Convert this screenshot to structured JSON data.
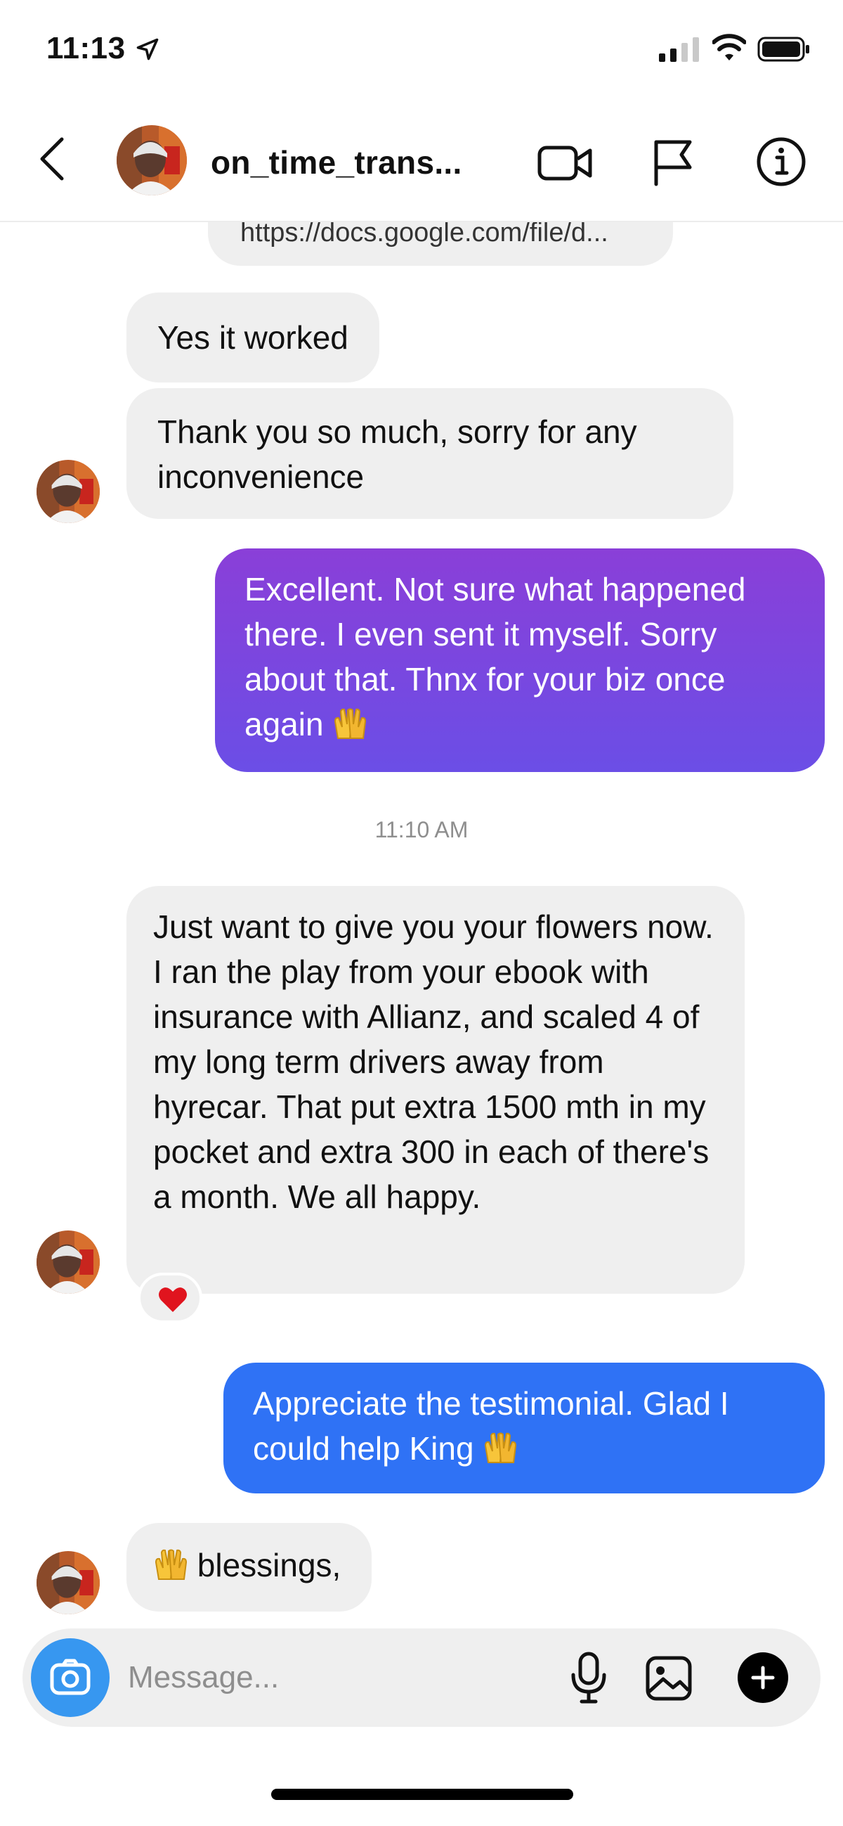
{
  "status_bar": {
    "time": "11:13"
  },
  "header": {
    "name": "on_time_trans..."
  },
  "thread": {
    "link_preview": "https://docs.google.com/file/d...",
    "messages": [
      {
        "side": "in",
        "text": "Yes it worked"
      },
      {
        "side": "in",
        "text": "Thank you so much, sorry for any inconvenience"
      },
      {
        "side": "out",
        "text": "Excellent. Not sure what happened there. I even sent it myself. Sorry about that. Thnx for your biz once again"
      },
      {
        "side": "in",
        "text": "Just want to give you your flowers now. I ran the play from your ebook with insurance with Allianz, and scaled 4 of my long term drivers away from hyrecar. That put extra 1500 mth in my pocket and extra 300 in each of there's a month.  We all happy."
      },
      {
        "side": "out",
        "text": "Appreciate the testimonial. Glad I could help King"
      },
      {
        "side": "in",
        "text": "blessings,"
      }
    ],
    "timestamp": "11:10 AM",
    "reaction": "heart"
  },
  "composer": {
    "placeholder": "Message..."
  },
  "icons": {
    "back": "chevron-left-icon",
    "video": "video-call-icon",
    "flag": "flag-icon",
    "info": "info-icon",
    "camera": "camera-icon",
    "mic": "microphone-icon",
    "gallery": "gallery-icon",
    "plus": "plus-icon",
    "emoji": "raised-hands-emoji"
  },
  "colors": {
    "incoming_bubble": "#efefef",
    "outgoing_purple": "#7a46dd",
    "outgoing_blue": "#2f72f5",
    "camera_button": "#3797f0",
    "heart": "#e0141e"
  }
}
